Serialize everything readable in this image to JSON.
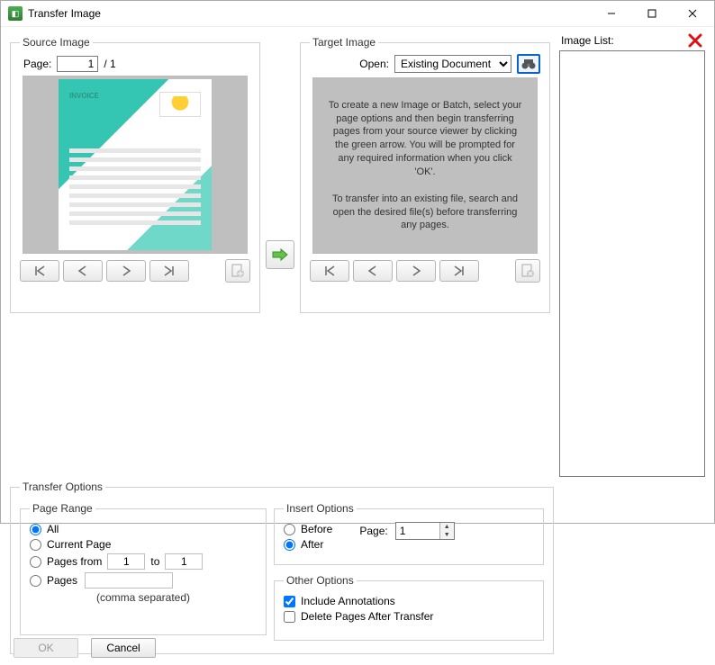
{
  "window": {
    "title": "Transfer Image"
  },
  "source": {
    "legend": "Source Image",
    "page_label": "Page:",
    "page_value": "1",
    "page_total": "/ 1",
    "doc_badge": "INVOICE"
  },
  "target": {
    "legend": "Target Image",
    "open_label": "Open:",
    "open_value": "Existing Document",
    "help_text": "To create a new Image or Batch, select your page options and then begin transferring pages from your source viewer by clicking the green arrow. You will be prompted for any required information when you click 'OK'.\n\nTo transfer into an existing file, search and open the desired file(s) before transferring any pages."
  },
  "image_list": {
    "label": "Image List:"
  },
  "transfer": {
    "legend": "Transfer Options",
    "page_range": {
      "legend": "Page Range",
      "all": "All",
      "current": "Current Page",
      "from_label": "Pages from",
      "from_value": "1",
      "to_label": "to",
      "to_value": "1",
      "pages_label": "Pages",
      "hint": "(comma separated)"
    },
    "insert": {
      "legend": "Insert Options",
      "before": "Before",
      "after": "After",
      "page_label": "Page:",
      "page_value": "1"
    },
    "other": {
      "legend": "Other Options",
      "include": "Include Annotations",
      "delete": "Delete Pages After Transfer"
    }
  },
  "buttons": {
    "ok": "OK",
    "cancel": "Cancel"
  }
}
